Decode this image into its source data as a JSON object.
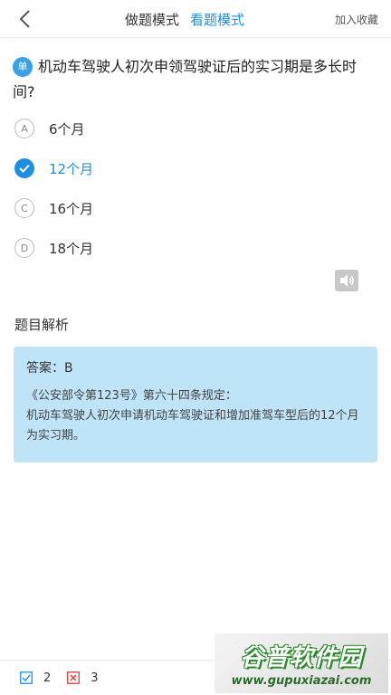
{
  "header": {
    "tabs": [
      {
        "label": "做题模式",
        "active": false
      },
      {
        "label": "看题模式",
        "active": true
      }
    ],
    "favorite_label": "加入收藏"
  },
  "question": {
    "type_badge": "单",
    "text": "机动车驾驶人初次申领驾驶证后的实习期是多长时间?"
  },
  "options": [
    {
      "letter": "A",
      "text": "6个月",
      "correct": false
    },
    {
      "letter": "B",
      "text": "12个月",
      "correct": true
    },
    {
      "letter": "C",
      "text": "16个月",
      "correct": false
    },
    {
      "letter": "D",
      "text": "18个月",
      "correct": false
    }
  ],
  "analysis": {
    "title": "题目解析",
    "answer": "答案：B",
    "explanation_line1": "《公安部令第123号》第六十四条规定：",
    "explanation_line2": "机动车驾驶人初次申请机动车驾驶证和增加准驾车型后的12个月为实习期。"
  },
  "footer": {
    "correct_count": "2",
    "wrong_count": "3"
  },
  "watermark": {
    "main": "谷普软件园",
    "url": "www.gupuxiazai.com"
  },
  "colors": {
    "accent": "#1e8fe0",
    "analysis_bg": "#bfe3f7",
    "correct_icon": "#1e8fe0",
    "wrong_icon": "#e53935"
  }
}
